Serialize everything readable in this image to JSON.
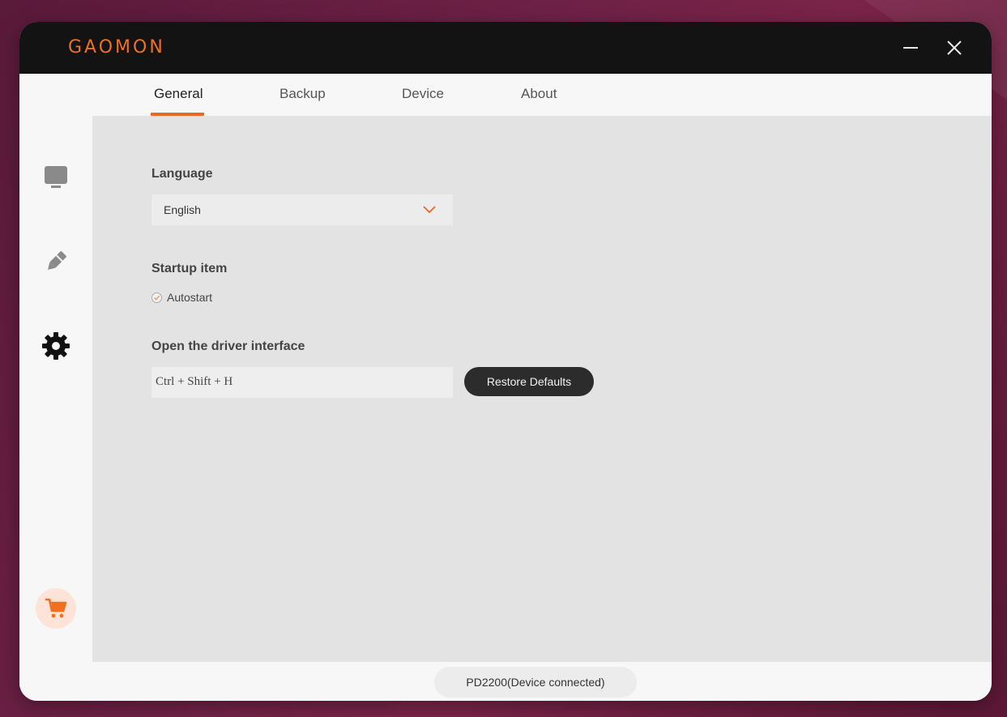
{
  "app": {
    "logo_text": "GAOMON",
    "brand_color": "#f07020"
  },
  "window_controls": {
    "minimize_icon": "minimize-icon",
    "close_icon": "close-icon"
  },
  "sidebar": {
    "items": [
      {
        "icon": "monitor-icon"
      },
      {
        "icon": "pen-icon"
      },
      {
        "icon": "gear-icon",
        "active": true
      }
    ],
    "cart_icon": "cart-icon"
  },
  "tabs": [
    {
      "label": "General",
      "active": true
    },
    {
      "label": "Backup"
    },
    {
      "label": "Device"
    },
    {
      "label": "About"
    }
  ],
  "general": {
    "language": {
      "title": "Language",
      "selected": "English"
    },
    "startup": {
      "title": "Startup item",
      "autostart_label": "Autostart",
      "autostart_checked": true
    },
    "driver": {
      "title": "Open the driver interface",
      "hotkey": "Ctrl + Shift + H",
      "restore_label": "Restore Defaults"
    }
  },
  "status": {
    "text": "PD2200(Device connected)"
  }
}
